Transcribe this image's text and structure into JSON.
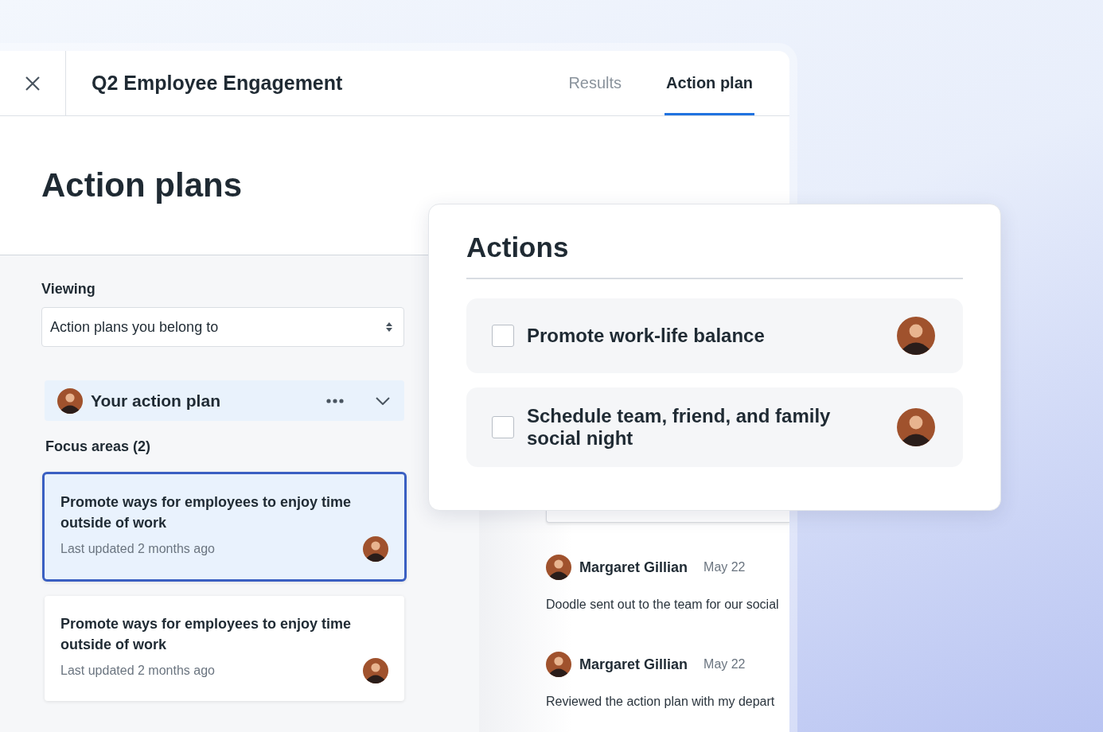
{
  "header": {
    "title": "Q2 Employee Engagement"
  },
  "tabs": [
    {
      "label": "Results",
      "selected": false
    },
    {
      "label": "Action plan",
      "selected": true
    }
  ],
  "page_title": "Action plans",
  "viewing": {
    "label": "Viewing",
    "value": "Action plans you belong to"
  },
  "plan": {
    "title": "Your action plan"
  },
  "focus_areas": {
    "heading": "Focus areas (2)",
    "items": [
      {
        "title": "Promote ways for employees to enjoy time outside of work",
        "updated": "Last updated 2 months ago",
        "selected": true
      },
      {
        "title": "Promote ways for employees to enjoy time outside of work",
        "updated": "Last updated 2 months ago",
        "selected": false
      }
    ]
  },
  "comments": [
    {
      "author": "Margaret Gillian",
      "date": "May 22",
      "text": "Doodle sent out to the team for our social"
    },
    {
      "author": "Margaret Gillian",
      "date": "May 22",
      "text": "Reviewed the action plan with my depart"
    }
  ],
  "actions_panel": {
    "title": "Actions",
    "items": [
      {
        "label": "Promote work-life balance",
        "checked": false
      },
      {
        "label": "Schedule team, friend, and family social night",
        "checked": false
      }
    ]
  }
}
